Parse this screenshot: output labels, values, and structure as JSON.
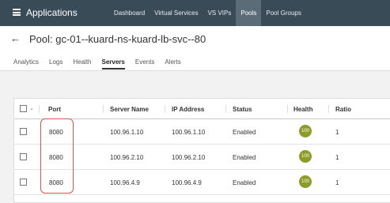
{
  "topbar": {
    "title": "Applications",
    "nav": [
      "Dashboard",
      "Virtual Services",
      "VS VIPs",
      "Pools",
      "Pool Groups"
    ],
    "active_nav": "Pools"
  },
  "page": {
    "title": "Pool: gc-01--kuard-ns-kuard-lb-svc--80"
  },
  "tabs": [
    "Analytics",
    "Logs",
    "Health",
    "Servers",
    "Events",
    "Alerts"
  ],
  "active_tab": "Servers",
  "table": {
    "columns": [
      "Port",
      "Server Name",
      "IP Address",
      "Status",
      "Health",
      "Ratio"
    ],
    "rows": [
      {
        "port": "8080",
        "server_name": "100.96.1.10",
        "ip": "100.96.1.10",
        "status": "Enabled",
        "health": "100",
        "ratio": "1"
      },
      {
        "port": "8080",
        "server_name": "100.96.2.10",
        "ip": "100.96.2.10",
        "status": "Enabled",
        "health": "100",
        "ratio": "1"
      },
      {
        "port": "8080",
        "server_name": "100.96.4.9",
        "ip": "100.96.4.9",
        "status": "Enabled",
        "health": "100",
        "ratio": "1"
      }
    ]
  },
  "colors": {
    "topbar": "#3a4b58",
    "active_nav": "#5b6c78",
    "health_badge": "#8c9b2a",
    "highlight": "#d9534f"
  }
}
